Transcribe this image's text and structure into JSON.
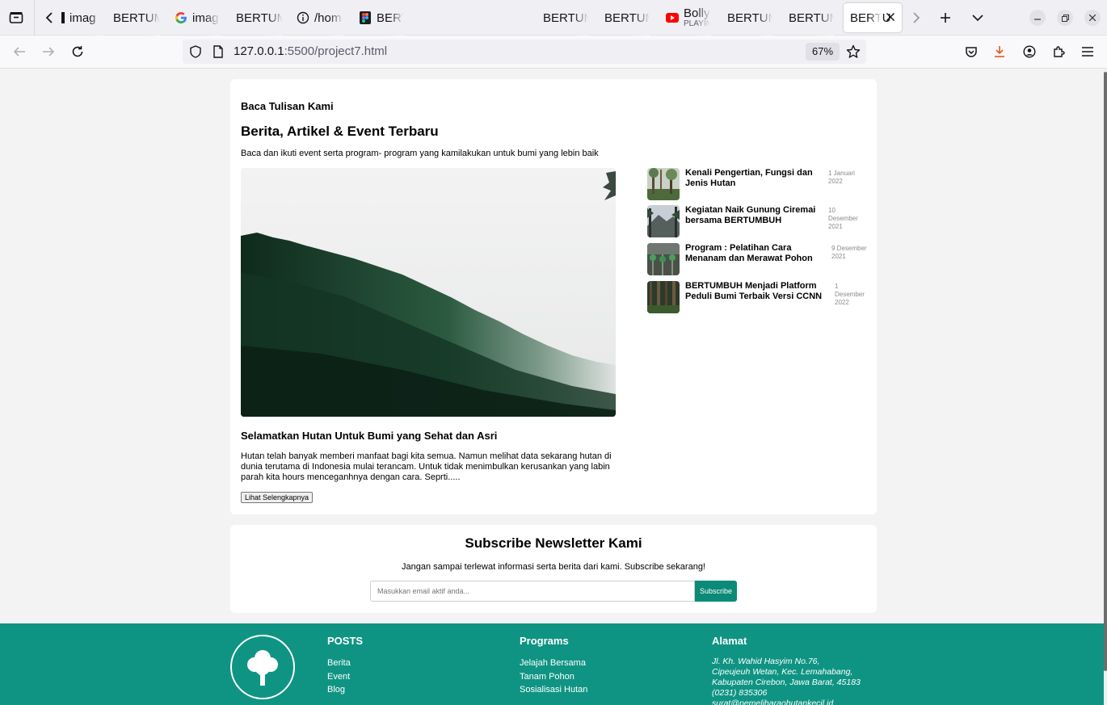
{
  "browser": {
    "tabs": [
      {
        "label": "imag",
        "icon": "page-icon"
      },
      {
        "label": "BERTUM",
        "icon": ""
      },
      {
        "label": "imag",
        "icon": "google-icon"
      },
      {
        "label": "BERTUM",
        "icon": ""
      },
      {
        "label": "/hom",
        "icon": "info-icon"
      },
      {
        "label": "BERT",
        "icon": "figma-icon"
      },
      {
        "label": "BERTUM",
        "icon": ""
      },
      {
        "label": "BERTUM",
        "icon": ""
      },
      {
        "label": "Bolly",
        "sublabel": "PLAYIN",
        "icon": "youtube-icon"
      },
      {
        "label": "BERTUM",
        "icon": ""
      },
      {
        "label": "BERTUM",
        "icon": ""
      },
      {
        "label": "BERTU",
        "icon": "",
        "active": true
      }
    ],
    "url_host": "127.0.0.1",
    "url_rest": ":5500/project7.html",
    "zoom": "67%"
  },
  "news": {
    "eyebrow": "Baca Tulisan Kami",
    "title": "Berita, Artikel & Event Terbaru",
    "description": "Baca dan ikuti event serta program- program yang kamilakukan untuk bumi yang lebin baik",
    "featured": {
      "title": "Selamatkan Hutan Untuk Bumi yang Sehat dan Asri",
      "body": "Hutan telah banyak memberi manfaat bagi kita semua. Namun melihat data sekarang hutan di dunia terutama di Indonesia mulai terancam. Untuk tidak menimbulkan kerusankan yang labin parah kita hours menceganhnya dengan cara. Seprti.....",
      "button": "Lihat Selengkapnya"
    },
    "items": [
      {
        "title": "Kenali Pengertian, Fungsi dan Jenis Hutan",
        "date": "1 Januari 2022"
      },
      {
        "title": "Kegiatan Naik Gunung Ciremai bersama BERTUMBUH",
        "date": "10 Desember 2021"
      },
      {
        "title": "Program : Pelatihan Cara Menanam dan Merawat Pohon",
        "date": "9 Desember 2021"
      },
      {
        "title": "BERTUMBUH Menjadi Platform Peduli Bumi Terbaik Versi CCNN",
        "date": "1 Desember 2022"
      }
    ]
  },
  "newsletter": {
    "title": "Subscribe Newsletter Kami",
    "description": "Jangan sampai terlewat informasi serta berita dari kami. Subscribe sekarang!",
    "placeholder": "Masukkan email aktif anda...",
    "button": "Subscribe"
  },
  "footer": {
    "posts": {
      "heading": "POSTS",
      "links": [
        "Berita",
        "Event",
        "Blog"
      ]
    },
    "programs": {
      "heading": "Programs",
      "links": [
        "Jelajah Bersama",
        "Tanam Pohon",
        "Sosialisasi Hutan"
      ]
    },
    "address": {
      "heading": "Alamat",
      "lines": [
        "Jl. Kh. Wahid Hasyim No.76,",
        "Cipeujeuh Wetan, Kec. Lemahabang,",
        "Kabupaten Cirebon, Jawa Barat, 45183",
        "(0231) 835306",
        "surat@pemeliharaohutankecil.id"
      ]
    }
  },
  "colors": {
    "accent": "#0f9483",
    "button": "#0b8a78"
  }
}
